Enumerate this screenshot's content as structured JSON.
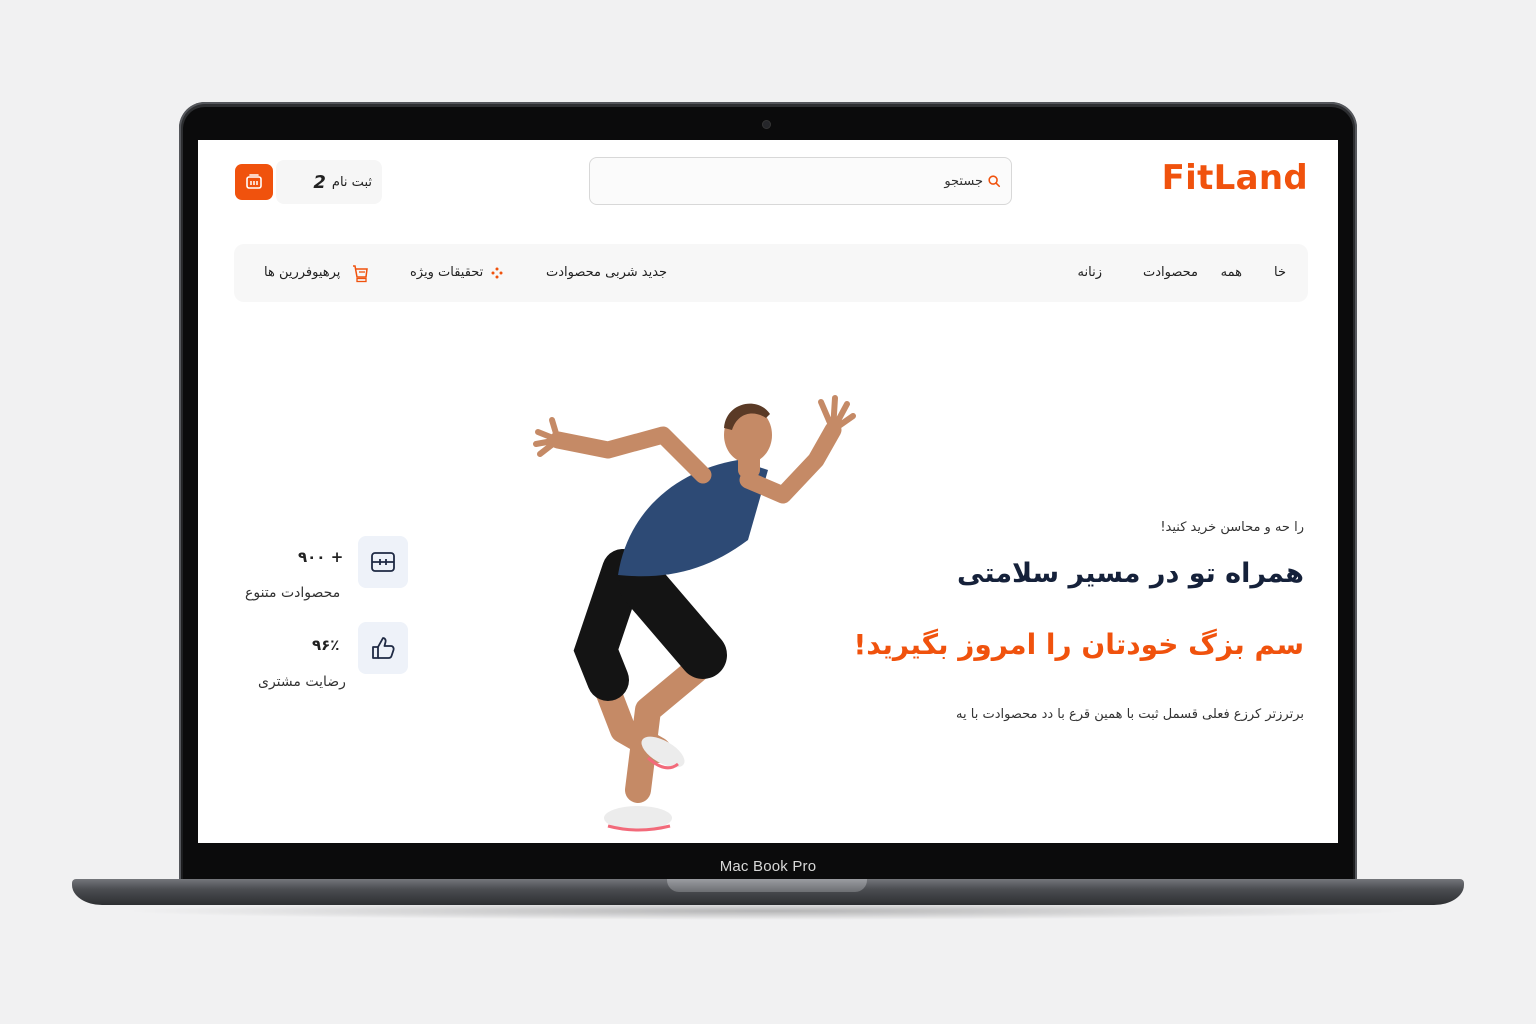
{
  "device": {
    "label": "Mac Book Pro"
  },
  "header": {
    "logo": "FitLand",
    "search_placeholder": "جستجو",
    "login_count": "2",
    "login_label": "ثبت نام"
  },
  "nav": {
    "items": [
      {
        "label": "خا"
      },
      {
        "label": "همه"
      },
      {
        "label": "محصوادت"
      },
      {
        "label": "زنانه"
      },
      {
        "label": "جدید شربی محصوادت"
      },
      {
        "label": "تحقیقات ویژه"
      },
      {
        "label": "پرهیوفررین ها"
      }
    ]
  },
  "hero": {
    "subtitle": "را حه و محاسن خرید کنید!",
    "title": "همراه تو در مسیر سلامتی",
    "highlight": "سم بزگ خودتان را امروز بگیرید!",
    "description": "برترزتر کرزع فعلی قسمل ثبت با همین قرع با دد محصوادت با یه"
  },
  "stats": [
    {
      "value": "+ ۹۰۰",
      "label": "محصوادت متنوع",
      "icon": "box-icon"
    },
    {
      "value": "۹۶٪",
      "label": "رضایت مشتری",
      "icon": "thumbs-up-icon"
    }
  ],
  "colors": {
    "accent": "#f0520d",
    "title": "#15213a",
    "stat_icon_bg": "#eef2f9"
  }
}
